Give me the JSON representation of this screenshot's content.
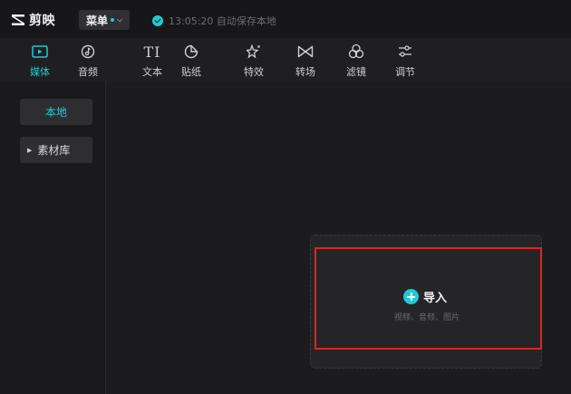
{
  "app": {
    "name": "剪映",
    "menu_label": "菜单",
    "save_status": "13:05:20 自动保存本地"
  },
  "toolbar": {
    "tabs": [
      {
        "label": "媒体",
        "icon": "media-icon",
        "active": true
      },
      {
        "label": "音频",
        "icon": "audio-icon",
        "active": false
      },
      {
        "label": "文本",
        "icon": "text-icon",
        "active": false
      },
      {
        "label": "贴纸",
        "icon": "sticker-icon",
        "active": false
      },
      {
        "label": "特效",
        "icon": "effects-icon",
        "active": false
      },
      {
        "label": "转场",
        "icon": "transition-icon",
        "active": false
      },
      {
        "label": "滤镜",
        "icon": "filter-icon",
        "active": false
      },
      {
        "label": "调节",
        "icon": "adjust-icon",
        "active": false
      }
    ]
  },
  "sidebar": {
    "items": [
      {
        "label": "本地",
        "active": true
      },
      {
        "label": "素材库",
        "expandable": true
      }
    ]
  },
  "import": {
    "label": "导入",
    "hint": "视频、音频、图片"
  },
  "colors": {
    "accent": "#1fcad6",
    "highlight": "#e3231f"
  }
}
